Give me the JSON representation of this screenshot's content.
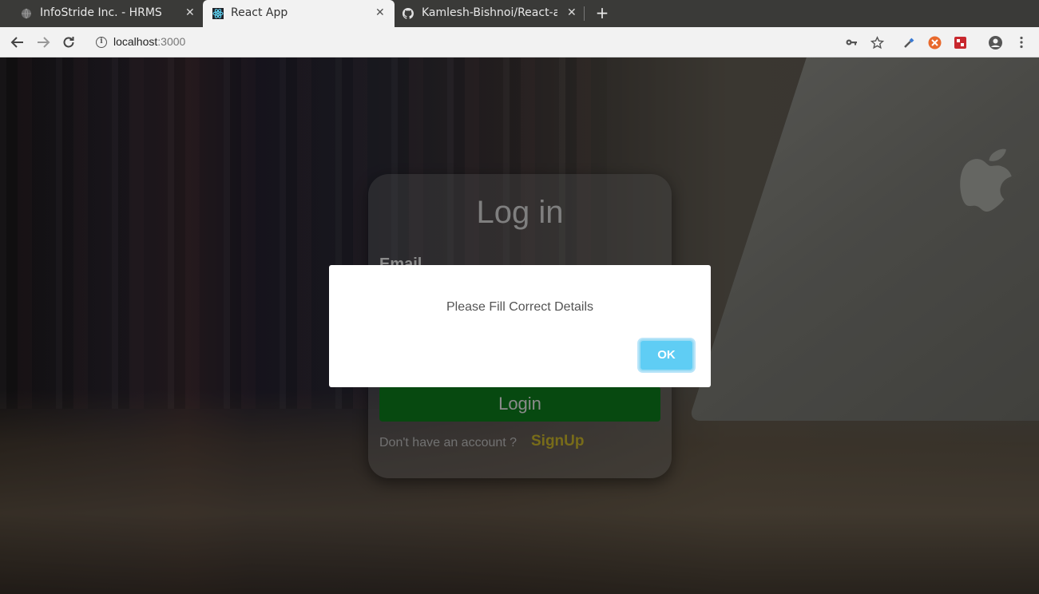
{
  "browser": {
    "tabs": [
      {
        "title": "InfoStride Inc. - HRMS",
        "close": "✕",
        "icon": "globe-icon"
      },
      {
        "title": "React App",
        "close": "✕",
        "icon": "react-icon"
      },
      {
        "title": "Kamlesh-Bishnoi/React-ap",
        "close": "✕",
        "icon": "github-icon"
      }
    ],
    "new_tab": "+",
    "url_host": "localhost",
    "url_port": ":3000"
  },
  "login": {
    "title": "Log in",
    "email_label": "Email",
    "login_button": "Login",
    "signup_prompt": "Don't have an account ?",
    "signup_link": "SignUp"
  },
  "alert": {
    "message": "Please Fill Correct Details",
    "ok": "OK"
  },
  "colors": {
    "login_button": "#0c7a1c",
    "signup_link": "#c8b42a",
    "ok_button": "#5fcdf4"
  }
}
